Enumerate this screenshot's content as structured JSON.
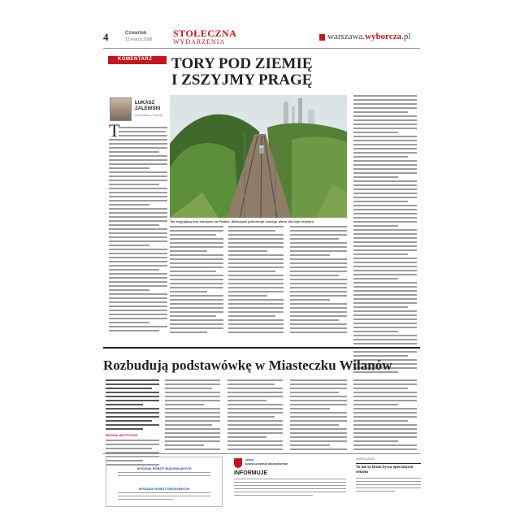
{
  "header": {
    "page_number": "4",
    "day": "Czwartek",
    "date": "13 marca 2008",
    "section_title": "STOŁECZNA",
    "section_subtitle": "WYDARZENIA",
    "site_prefix": "warszawa.",
    "site_brand": "wyborcza",
    "site_suffix": ".pl"
  },
  "article1": {
    "kicker": "KOMENTARZ",
    "headline_line1": "TORY POD ZIEMIĘ",
    "headline_line2": "I ZSZYJMY PRAGĘ",
    "author_first": "ŁUKASZ",
    "author_last": "ZALEWSKI",
    "author_role": "dziennikarz Gazety",
    "drop_cap": "T",
    "photo_caption": "Tak wyglądają tory kolejowe na Pradze. Warszawa potrzebuje nowego planu dla tego obszaru"
  },
  "article2": {
    "headline": "Rozbudują podstawówkę w Miasteczku Wilanów",
    "lead_author": "MICHAŁ WOJTCZUK"
  },
  "footer_ads": {
    "left_title1": "WYDZIAŁ ROBÓT BUDOWLANYCH",
    "left_title2": "WYDZIAŁ ROBÓT DROGOWYCH",
    "middle_org_line1": "URZĄD",
    "middle_org_line2": "MARSZAŁKOWSKI WOJEWÓDZTWA",
    "middle_title": "INFORMUJE",
    "right_kicker": "WARSZAWA",
    "right_title": "To nie ta firma bywa operatorem rekiem"
  },
  "colors": {
    "brand_red": "#c4161c",
    "text_gray": "#9c9c9c",
    "ad_blue": "#1e4d8c"
  }
}
